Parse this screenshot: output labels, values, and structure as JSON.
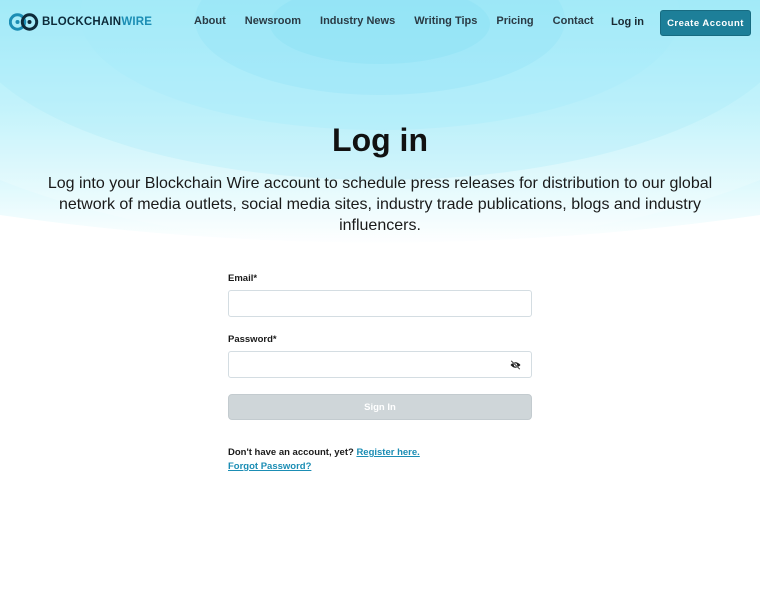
{
  "brand": {
    "logo_text_a": "BLOCKCHAIN",
    "logo_text_b": "WIRE"
  },
  "nav": {
    "items": [
      {
        "label": "About"
      },
      {
        "label": "Newsroom"
      },
      {
        "label": "Industry News"
      },
      {
        "label": "Writing Tips"
      },
      {
        "label": "Pricing"
      },
      {
        "label": "Contact"
      }
    ]
  },
  "header": {
    "login_label": "Log in",
    "create_account_label": "Create Account"
  },
  "hero": {
    "title": "Log in",
    "subtitle": "Log into your Blockchain Wire account to schedule press releases for distribution to our global network of media outlets, social media sites, industry trade publications, blogs and industry influencers."
  },
  "form": {
    "email_label": "Email*",
    "email_value": "",
    "password_label": "Password*",
    "password_value": "",
    "password_toggle_icon": "eye-slash-icon",
    "submit_label": "Sign In"
  },
  "footer_links": {
    "no_account_text": "Don't have an account, yet?",
    "register_label": "Register here.",
    "forgot_label": "Forgot Password?"
  },
  "colors": {
    "accent": "#1d7f99",
    "link": "#1b8db4",
    "hero_top": "#8ee6f8",
    "button_disabled": "#cfd6d9"
  }
}
